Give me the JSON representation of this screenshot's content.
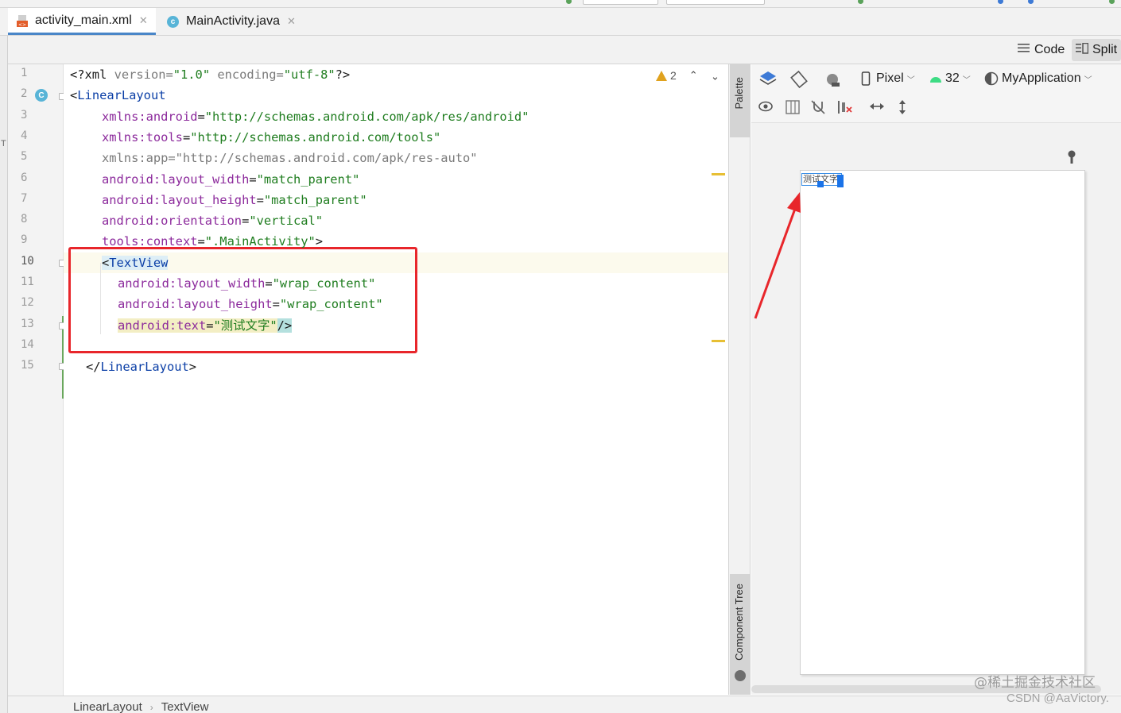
{
  "tabs": [
    {
      "label": "activity_main.xml",
      "icon": "xml-file-icon",
      "active": true
    },
    {
      "label": "MainActivity.java",
      "icon": "java-class-icon",
      "active": false
    }
  ],
  "view_modes": {
    "code": "Code",
    "split": "Split",
    "selected": "Split"
  },
  "editor": {
    "line_numbers": [
      "1",
      "2",
      "3",
      "4",
      "5",
      "6",
      "7",
      "8",
      "9",
      "10",
      "11",
      "12",
      "13",
      "14",
      "15"
    ],
    "current_line": "10",
    "class_gutter_badge": "C",
    "inspection": {
      "warning_count": "2"
    },
    "lines": [
      [
        "<?xml ",
        "version=",
        "\"1.0\"",
        " encoding=",
        "\"utf-8\"",
        "?>"
      ],
      [
        "<",
        "LinearLayout"
      ],
      [
        "xmlns:",
        "android",
        "=",
        "\"http://schemas.android.com/apk/res/android\""
      ],
      [
        "xmlns:",
        "tools",
        "=",
        "\"http://schemas.android.com/tools\""
      ],
      [
        "xmlns:app=\"http://schemas.android.com/apk/res-auto\""
      ],
      [
        "android:",
        "layout_width",
        "=",
        "\"match_parent\""
      ],
      [
        "android:",
        "layout_height",
        "=",
        "\"match_parent\""
      ],
      [
        "android:",
        "orientation",
        "=",
        "\"vertical\""
      ],
      [
        "tools:",
        "context",
        "=",
        "\".MainActivity\"",
        ">"
      ],
      [
        "<",
        "TextView"
      ],
      [
        "android:",
        "layout_width",
        "=",
        "\"wrap_content\""
      ],
      [
        "android:",
        "layout_height",
        "=",
        "\"wrap_content\""
      ],
      [
        "android:",
        "text",
        "=",
        "\"测试文字\"",
        "/>"
      ],
      [],
      [
        "</",
        "LinearLayout",
        ">"
      ]
    ]
  },
  "side_panels": {
    "palette": "Palette",
    "component_tree": "Component Tree"
  },
  "design_toolbar": {
    "device": "Pixel",
    "api_level": "32",
    "theme": "MyApplication"
  },
  "preview": {
    "textview_text": "测试文字"
  },
  "breadcrumb": [
    "LinearLayout",
    "TextView"
  ],
  "watermark": {
    "line1": "@稀土掘金技术社区",
    "line2": "CSDN @AaVictory."
  },
  "colors": {
    "accent": "#4a86c8",
    "annotation_red": "#e8262b",
    "selection_blue": "#1a73e8",
    "warning": "#e0a21e"
  }
}
